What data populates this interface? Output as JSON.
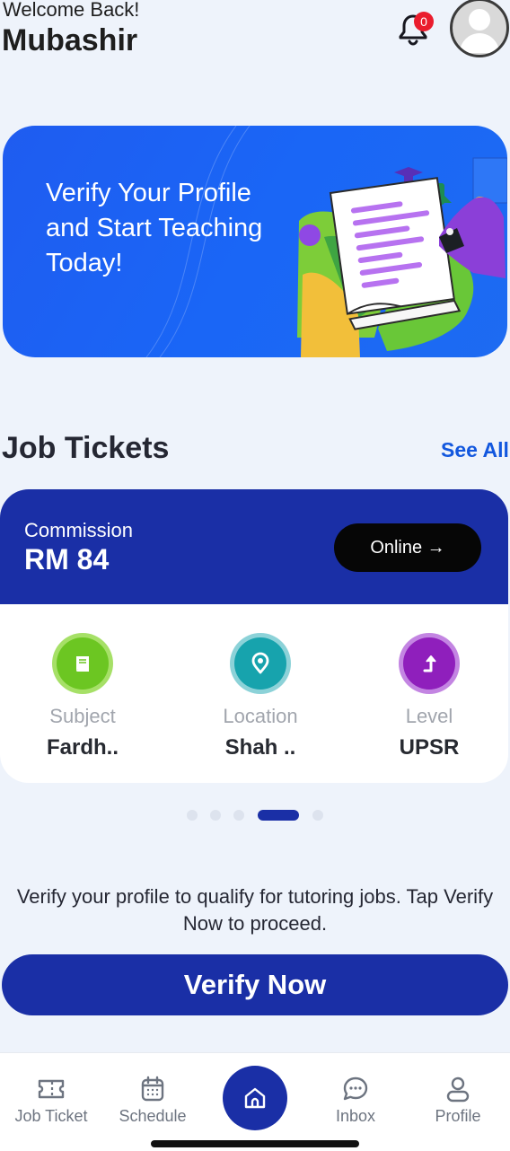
{
  "header": {
    "greeting": "Welcome Back!",
    "username": "Mubashir",
    "notification_count": "0"
  },
  "banner": {
    "text": "Verify Your Profile and Start Teaching Today!"
  },
  "job_tickets": {
    "title": "Job Tickets",
    "see_all": "See All",
    "card": {
      "commission_label": "Commission",
      "commission_value": "RM 84",
      "mode_button": "Online →",
      "subject_label": "Subject",
      "subject_value": "Fardh..",
      "location_label": "Location",
      "location_value": "Shah ..",
      "level_label": "Level",
      "level_value": "UPSR"
    },
    "carousel": {
      "total": 5,
      "active_index": 3
    }
  },
  "verify": {
    "message": "Verify your profile to qualify for tutoring jobs. Tap Verify Now to proceed.",
    "button": "Verify Now"
  },
  "bottom_nav": {
    "job_ticket": "Job Ticket",
    "schedule": "Schedule",
    "inbox": "Inbox",
    "profile": "Profile"
  },
  "colors": {
    "primary": "#1a2fa6",
    "link": "#1257de",
    "badge": "#ea1c2d",
    "banner": "#1d67f2",
    "subject_icon": "#6cc622",
    "location_icon": "#17a3ad",
    "level_icon": "#8f1fbc"
  },
  "icons": {
    "notification": "bell-icon",
    "avatar": "user-avatar-icon",
    "subject": "book-icon",
    "location": "location-pin-icon",
    "level": "level-arrow-icon",
    "nav_job_ticket": "ticket-icon",
    "nav_schedule": "calendar-icon",
    "nav_home": "home-icon",
    "nav_inbox": "chat-icon",
    "nav_profile": "profile-icon"
  }
}
